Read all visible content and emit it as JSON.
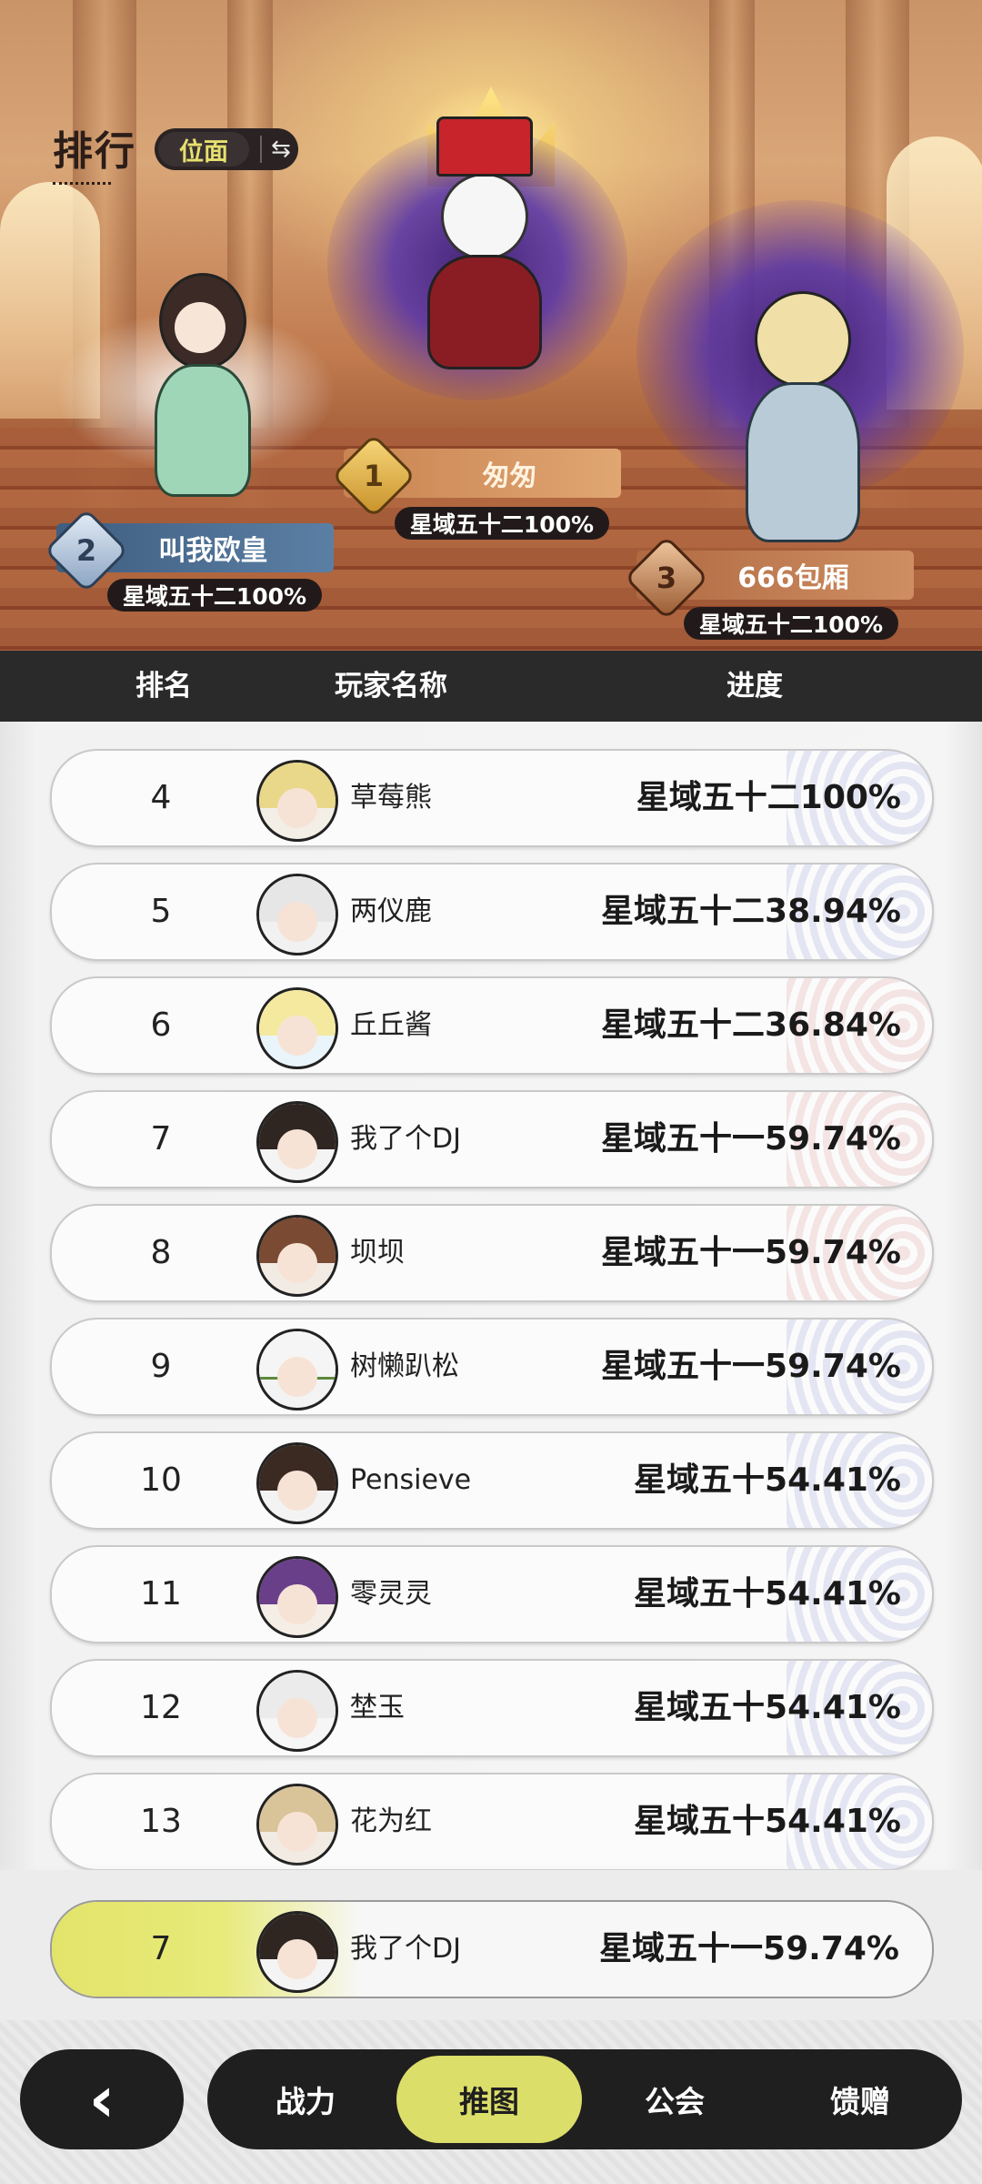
{
  "header": {
    "title": "排行",
    "scope_label": "位面",
    "swap_icon": "⇆"
  },
  "podium": [
    {
      "rank": "1",
      "name": "匆匆",
      "progress": "星域五十二100%"
    },
    {
      "rank": "2",
      "name": "叫我欧皇",
      "progress": "星域五十二100%"
    },
    {
      "rank": "3",
      "name": "666包厢",
      "progress": "星域五十二100%"
    }
  ],
  "columns": {
    "rank": "排名",
    "name": "玩家名称",
    "progress": "进度"
  },
  "rows": [
    {
      "rank": "4",
      "name": "草莓熊",
      "progress": "星域五十二100%"
    },
    {
      "rank": "5",
      "name": "两仪鹿",
      "progress": "星域五十二38.94%"
    },
    {
      "rank": "6",
      "name": "丘丘酱",
      "progress": "星域五十二36.84%"
    },
    {
      "rank": "7",
      "name": "我了个DJ",
      "progress": "星域五十一59.74%"
    },
    {
      "rank": "8",
      "name": "坝坝",
      "progress": "星域五十一59.74%"
    },
    {
      "rank": "9",
      "name": "树懒趴松",
      "progress": "星域五十一59.74%"
    },
    {
      "rank": "10",
      "name": "Pensieve",
      "progress": "星域五十54.41%"
    },
    {
      "rank": "11",
      "name": "零灵灵",
      "progress": "星域五十54.41%"
    },
    {
      "rank": "12",
      "name": "埜玉",
      "progress": "星域五十54.41%"
    },
    {
      "rank": "13",
      "name": "花为红",
      "progress": "星域五十54.41%"
    }
  ],
  "self": {
    "rank": "7",
    "name": "我了个DJ",
    "progress": "星域五十一59.74%"
  },
  "nav": {
    "back_icon": "‹",
    "tabs": [
      {
        "label": "战力"
      },
      {
        "label": "推图",
        "active": true
      },
      {
        "label": "公会"
      },
      {
        "label": "馈赠"
      }
    ]
  },
  "colors": {
    "accent": "#dcde6a",
    "dark": "#1f1f1f",
    "gold": "#e8b64a"
  }
}
